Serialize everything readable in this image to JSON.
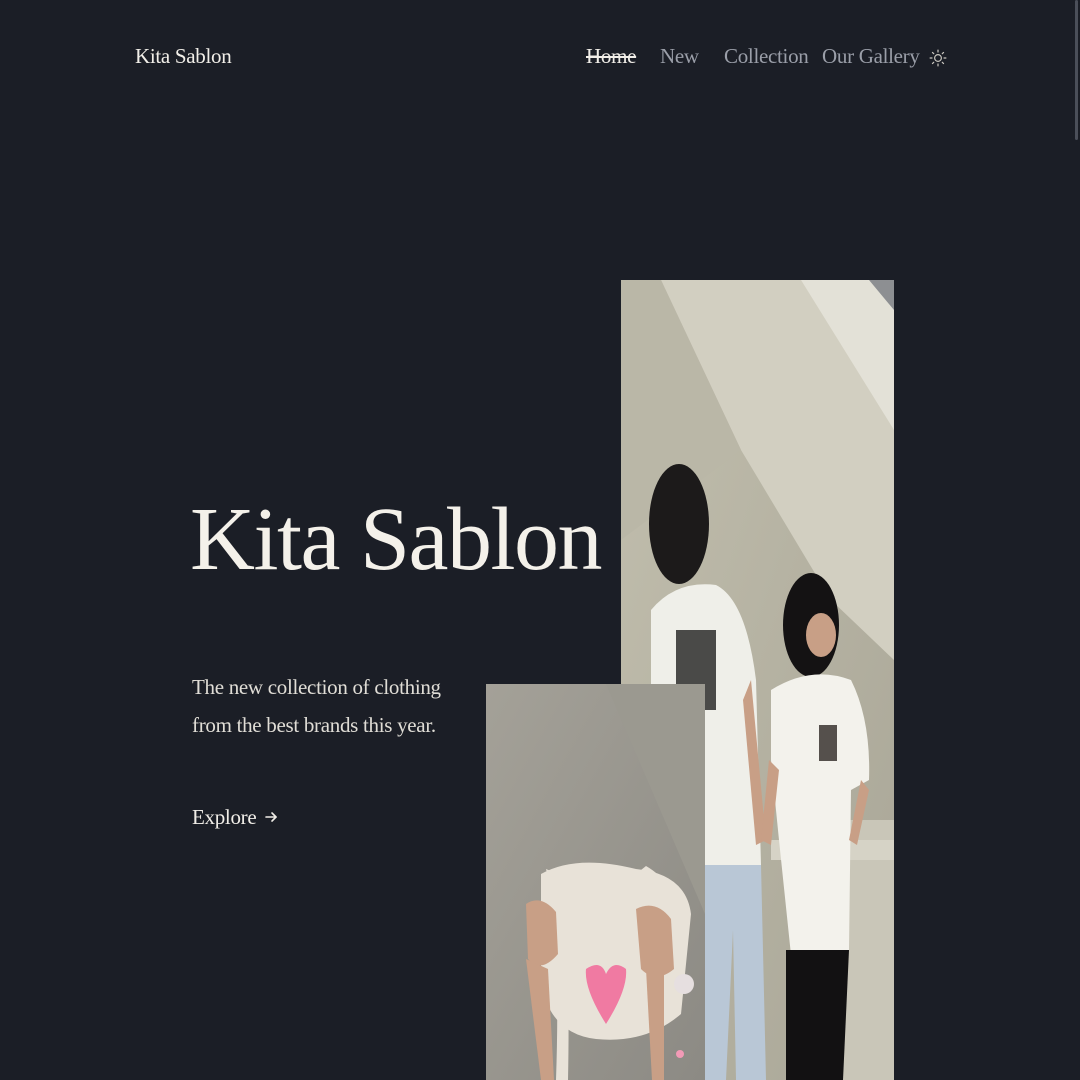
{
  "brand": {
    "name": "Kita Sablon"
  },
  "nav": {
    "items": [
      {
        "label": "Home",
        "active": true
      },
      {
        "label": "New",
        "active": false
      },
      {
        "label": "Collection",
        "active": false
      },
      {
        "label": "Our Gallery",
        "active": false
      }
    ],
    "theme_icon": "sun-icon"
  },
  "hero": {
    "title": "Kita Sablon",
    "subtitle": "The new collection of clothing from the best brands this year.",
    "cta_label": "Explore",
    "cta_icon": "arrow-right-icon"
  },
  "colors": {
    "background": "#1b1e26",
    "text": "#f1eee8",
    "muted_text": "#9a9ea8"
  }
}
